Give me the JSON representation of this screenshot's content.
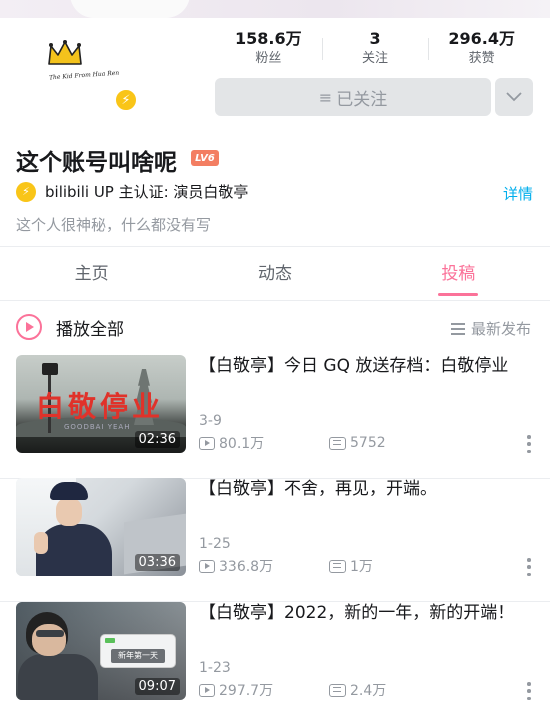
{
  "profile": {
    "avatar_caption": "The Kid From Hua Ren",
    "stats": [
      {
        "value": "158.6万",
        "label": "粉丝"
      },
      {
        "value": "3",
        "label": "关注"
      },
      {
        "value": "296.4万",
        "label": "获赞"
      }
    ],
    "follow_label": "已关注",
    "username": "这个账号叫啥呢",
    "level": "LV6",
    "verify_text": "bilibili UP 主认证: 演员白敬亭",
    "detail_link": "详情",
    "bio": "这个人很神秘，什么都没有写"
  },
  "tabs": [
    {
      "label": "主页"
    },
    {
      "label": "动态"
    },
    {
      "label": "投稿"
    }
  ],
  "list_header": {
    "play_all": "播放全部",
    "sort": "最新发布"
  },
  "videos": [
    {
      "title": "【白敬亭】今日 GQ 放送存档：白敬停业",
      "thumb_text": "白敬停业",
      "thumb_sub": "GOODBAI YEAH",
      "duration": "02:36",
      "date": "3-9",
      "views": "80.1万",
      "danmaku": "5752"
    },
    {
      "title": "【白敬亭】不舍，再见，开端。",
      "duration": "03:36",
      "date": "1-25",
      "views": "336.8万",
      "danmaku": "1万"
    },
    {
      "title": "【白敬亭】2022，新的一年，新的开端！",
      "thumb_text": "新年第一天",
      "duration": "09:07",
      "date": "1-23",
      "views": "297.7万",
      "danmaku": "2.4万"
    }
  ],
  "colors": {
    "accent_pink": "#fb7299",
    "link_blue": "#00aeec",
    "badge_yellow": "#f9c518",
    "level_orange": "#f37e62"
  }
}
